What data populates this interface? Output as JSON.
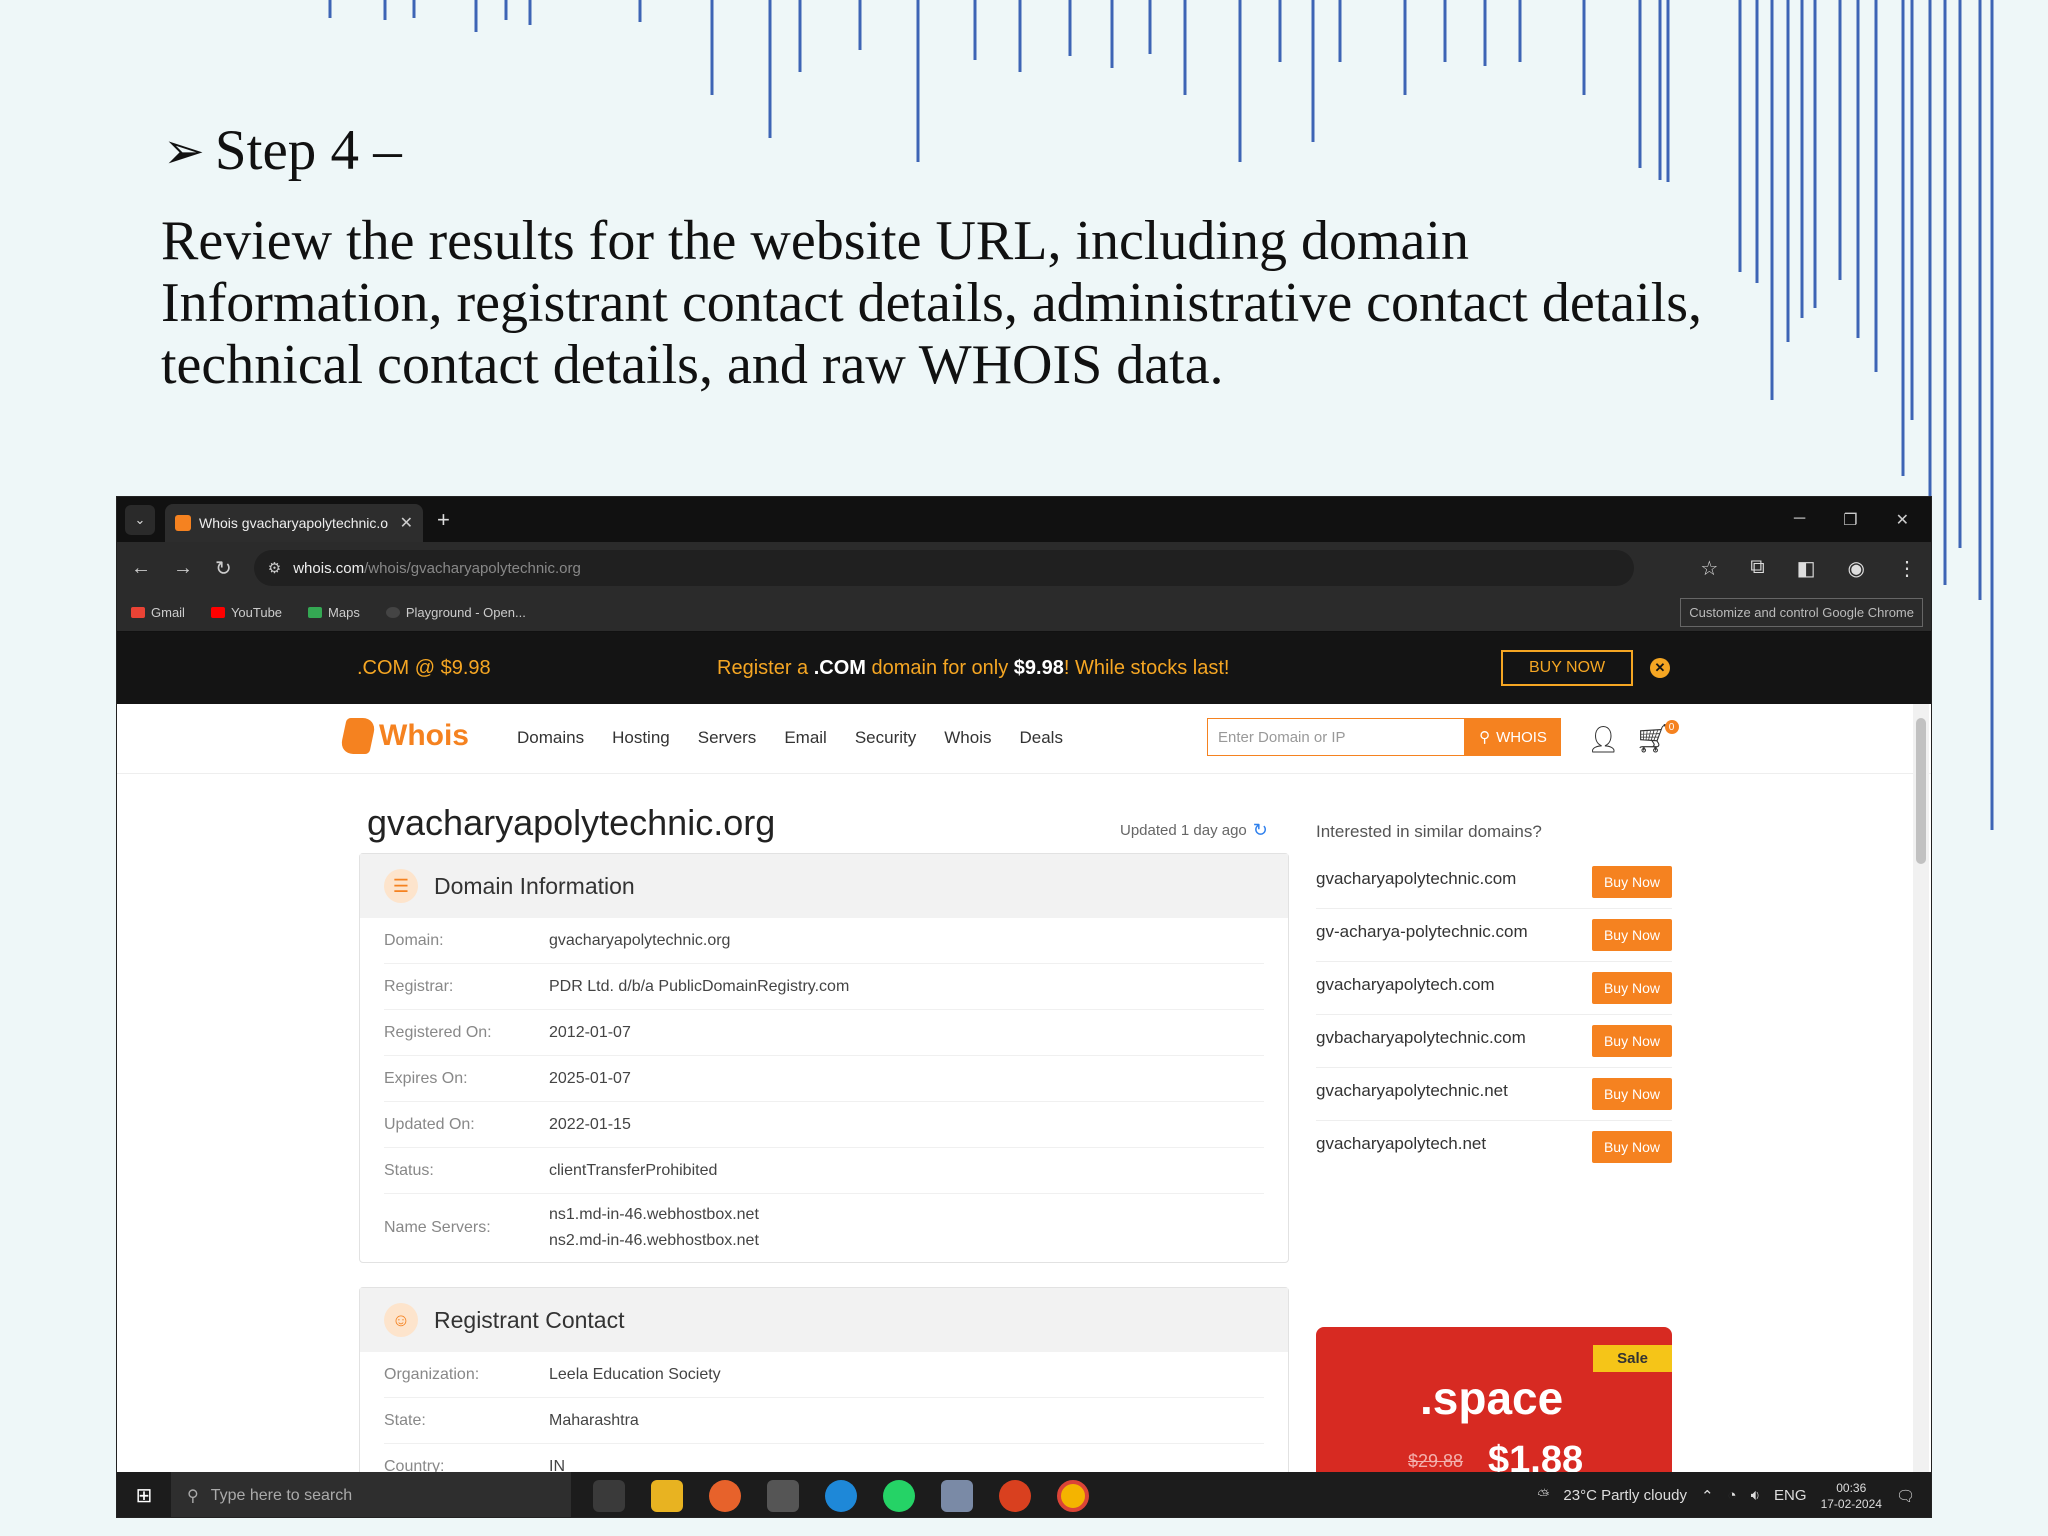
{
  "slide": {
    "step_arrow": "➢",
    "step_title": "Step 4 –",
    "paragraph_lines": [
      "Review the results for the website URL, including domain",
      "Information, registrant contact details, administrative contact details,",
      "technical contact details, and raw WHOIS data."
    ]
  },
  "browser": {
    "tab_title": "Whois gvacharyapolytechnic.o",
    "url_host": "whois.com",
    "url_path": "/whois/gvacharyapolytechnic.org",
    "bookmarks": [
      "Gmail",
      "YouTube",
      "Maps",
      "Playground - Open..."
    ],
    "customize_label": "Customize and control Google Chrome"
  },
  "promo": {
    "left": ".COM @ $9.98",
    "mid_pre": "Register a ",
    "mid_com": ".COM",
    "mid_mid": " domain for only ",
    "mid_price": "$9.98",
    "mid_post": "! While stocks last!",
    "buy_label": "BUY NOW"
  },
  "site": {
    "logo": "Whois",
    "menu": [
      "Domains",
      "Hosting",
      "Servers",
      "Email",
      "Security",
      "Whois",
      "Deals"
    ],
    "search_placeholder": "Enter Domain or IP",
    "search_button": "WHOIS",
    "cart_count": "0"
  },
  "result": {
    "domain_title": "gvacharyapolytechnic.org",
    "updated": "Updated 1 day ago",
    "domain_info_header": "Domain Information",
    "domain_info": [
      {
        "k": "Domain:",
        "v": "gvacharyapolytechnic.org"
      },
      {
        "k": "Registrar:",
        "v": "PDR Ltd. d/b/a PublicDomainRegistry.com"
      },
      {
        "k": "Registered On:",
        "v": "2012-01-07"
      },
      {
        "k": "Expires On:",
        "v": "2025-01-07"
      },
      {
        "k": "Updated On:",
        "v": "2022-01-15"
      },
      {
        "k": "Status:",
        "v": "clientTransferProhibited"
      },
      {
        "k": "Name Servers:",
        "v": "ns1.md-in-46.webhostbox.net",
        "v2": "ns2.md-in-46.webhostbox.net"
      }
    ],
    "registrant_header": "Registrant Contact",
    "registrant": [
      {
        "k": "Organization:",
        "v": "Leela Education Society"
      },
      {
        "k": "State:",
        "v": "Maharashtra"
      },
      {
        "k": "Country:",
        "v": "IN"
      }
    ]
  },
  "similar": {
    "question": "Interested in similar domains?",
    "buy_label": "Buy Now",
    "items": [
      "gvacharyapolytechnic.com",
      "gv-acharya-polytechnic.com",
      "gvacharyapolytech.com",
      "gvbacharyapolytechnic.com",
      "gvacharyapolytechnic.net",
      "gvacharyapolytech.net"
    ]
  },
  "sale": {
    "tag": "Sale",
    "tld": ".space",
    "old_price": "$29.88",
    "new_price": "$1.88"
  },
  "taskbar": {
    "search_placeholder": "Type here to search",
    "weather": "23°C  Partly cloudy",
    "lang": "ENG",
    "time": "00:36",
    "date": "17-02-2024"
  },
  "colors": {
    "accent": "#f58220",
    "promo_bg": "#141414",
    "sale_bg": "#d72a22"
  }
}
